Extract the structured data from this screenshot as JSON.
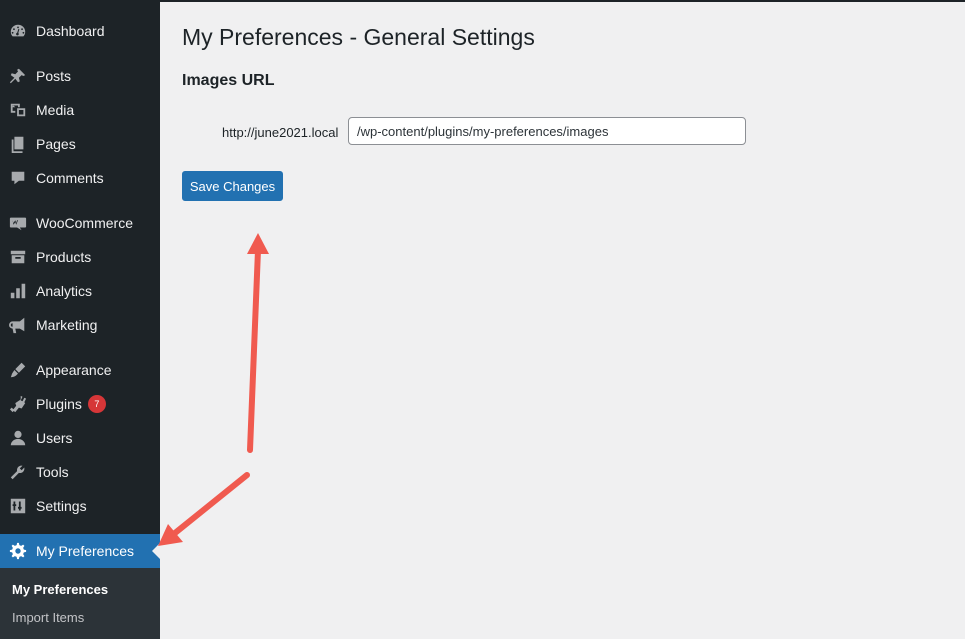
{
  "sidebar": {
    "items": [
      {
        "label": "Dashboard",
        "icon": "dashboard-icon"
      },
      {
        "label": "Posts",
        "icon": "pushpin-icon"
      },
      {
        "label": "Media",
        "icon": "media-icon"
      },
      {
        "label": "Pages",
        "icon": "pages-icon"
      },
      {
        "label": "Comments",
        "icon": "comment-icon"
      },
      {
        "label": "WooCommerce",
        "icon": "woocommerce-icon"
      },
      {
        "label": "Products",
        "icon": "archive-icon"
      },
      {
        "label": "Analytics",
        "icon": "bar-chart-icon"
      },
      {
        "label": "Marketing",
        "icon": "megaphone-icon"
      },
      {
        "label": "Appearance",
        "icon": "paintbrush-icon"
      },
      {
        "label": "Plugins",
        "icon": "plug-icon",
        "badge": "7"
      },
      {
        "label": "Users",
        "icon": "user-icon"
      },
      {
        "label": "Tools",
        "icon": "wrench-icon"
      },
      {
        "label": "Settings",
        "icon": "sliders-icon"
      },
      {
        "label": "My Preferences",
        "icon": "gear-icon",
        "active": true
      }
    ],
    "submenu": [
      {
        "label": "My Preferences",
        "current": true
      },
      {
        "label": "Import Items"
      }
    ]
  },
  "main": {
    "title": "My Preferences - General Settings",
    "section_title": "Images URL",
    "field": {
      "label": "http://june2021.local",
      "value": "/wp-content/plugins/my-preferences/images"
    },
    "save_label": "Save Changes"
  },
  "colors": {
    "sidebar_bg": "#1d2327",
    "active_bg": "#2271b1",
    "badge": "#d63638",
    "arrow": "#f05a4f",
    "page_bg": "#f0f0f1"
  }
}
